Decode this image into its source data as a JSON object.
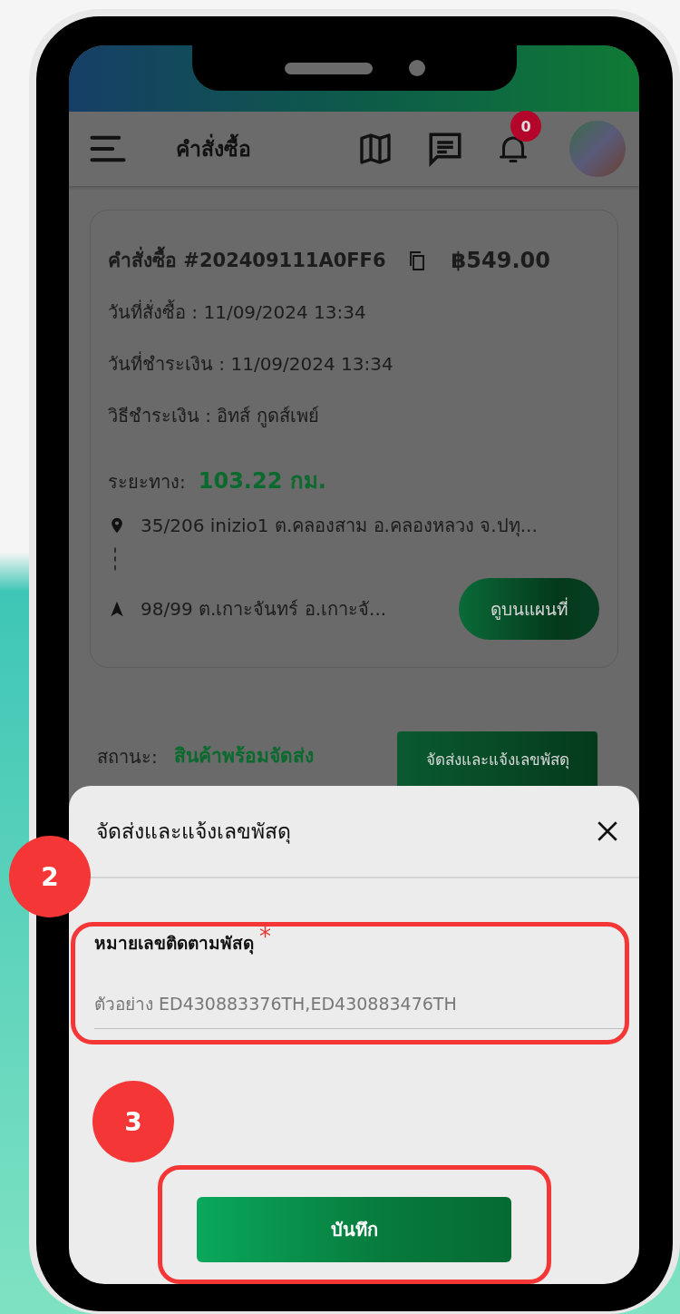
{
  "app_bar": {
    "title": "คำสั่งซื้อ",
    "notification_count": "0"
  },
  "order": {
    "title": "คำสั่งซื้อ #202409111A0FF6",
    "total": "฿549.00",
    "details": [
      "วันที่สั่งซื้อ : 11/09/2024 13:34",
      "วันที่ชำระเงิน : 11/09/2024 13:34",
      "วิธีชำระเงิน : อิทส์ กูดส์เพย์"
    ],
    "distance_label": "ระยะทาง:",
    "distance": "103.22 กม.",
    "origin": "35/206 inizio1 ต.คลองสาม อ.คลองหลวง จ.ปทุ...",
    "destination": "98/99  ต.เกาะจันทร์ อ.เกาะจั...",
    "map_button": "ดูบนแผนที่"
  },
  "status": {
    "label": "สถานะ:",
    "value": "สินค้าพร้อมจัดส่ง",
    "action_button": "จัดส่งและแจ้งเลขพัสดุ"
  },
  "sheet": {
    "title": "จัดส่งและแจ้งเลขพัสดุ",
    "field": {
      "label": "หมายเลขติดตามพัสดุ",
      "required_mark": "*",
      "placeholder": "ตัวอย่าง ED430883376TH,ED430883476TH"
    },
    "save_button": "บันทึก"
  },
  "annotations": [
    {
      "number": "2"
    },
    {
      "number": "3"
    }
  ]
}
